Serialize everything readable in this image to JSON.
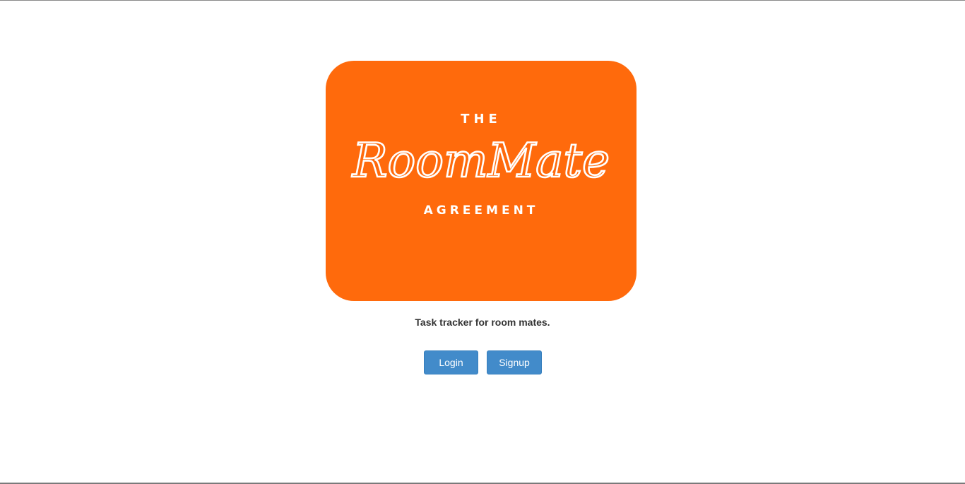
{
  "logo": {
    "line_top": "THE",
    "line_main": "RoomMate",
    "line_bottom": "AGREEMENT",
    "background_color": "#ff6a0c"
  },
  "tagline": "Task tracker for room mates.",
  "actions": {
    "login_label": "Login",
    "signup_label": "Signup",
    "button_color": "#428bca"
  }
}
